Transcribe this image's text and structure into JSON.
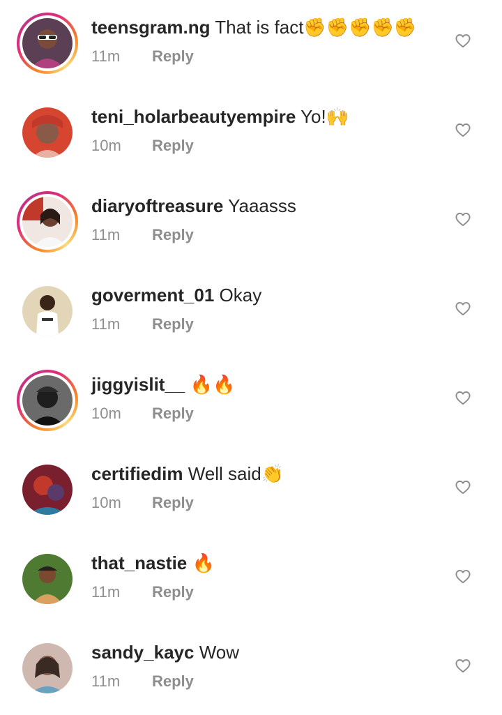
{
  "comments": [
    {
      "username": "teensgram.ng",
      "text": "That is fact✊✊✊✊✊",
      "time": "11m",
      "reply": "Reply",
      "story_ring": true,
      "avatar_color": "#3b2a3a",
      "like_icon": "heart-outline-icon"
    },
    {
      "username": "teni_holarbeautyempire",
      "text": "Yo!🙌",
      "time": "10m",
      "reply": "Reply",
      "story_ring": false,
      "avatar_color": "#c0392b",
      "like_icon": "heart-outline-icon"
    },
    {
      "username": "diaryoftreasure",
      "text": "Yaaasss",
      "time": "11m",
      "reply": "Reply",
      "story_ring": true,
      "avatar_color": "#e9dcd6",
      "like_icon": "heart-outline-icon"
    },
    {
      "username": "goverment_01",
      "text": "Okay",
      "time": "11m",
      "reply": "Reply",
      "story_ring": false,
      "avatar_color": "#d9c7a0",
      "like_icon": "heart-outline-icon"
    },
    {
      "username": "jiggyislit__",
      "text": "🔥🔥",
      "time": "10m",
      "reply": "Reply",
      "story_ring": true,
      "avatar_color": "#4a4a4a",
      "like_icon": "heart-outline-icon"
    },
    {
      "username": "certifiedim",
      "text": "Well said👏",
      "time": "10m",
      "reply": "Reply",
      "story_ring": false,
      "avatar_color": "#8e2a3a",
      "like_icon": "heart-outline-icon"
    },
    {
      "username": "that_nastie",
      "text": "🔥",
      "time": "11m",
      "reply": "Reply",
      "story_ring": false,
      "avatar_color": "#5a7a3a",
      "like_icon": "heart-outline-icon"
    },
    {
      "username": "sandy_kayc",
      "text": "Wow",
      "time": "11m",
      "reply": "Reply",
      "story_ring": false,
      "avatar_color": "#b59a93",
      "like_icon": "heart-outline-icon"
    }
  ]
}
